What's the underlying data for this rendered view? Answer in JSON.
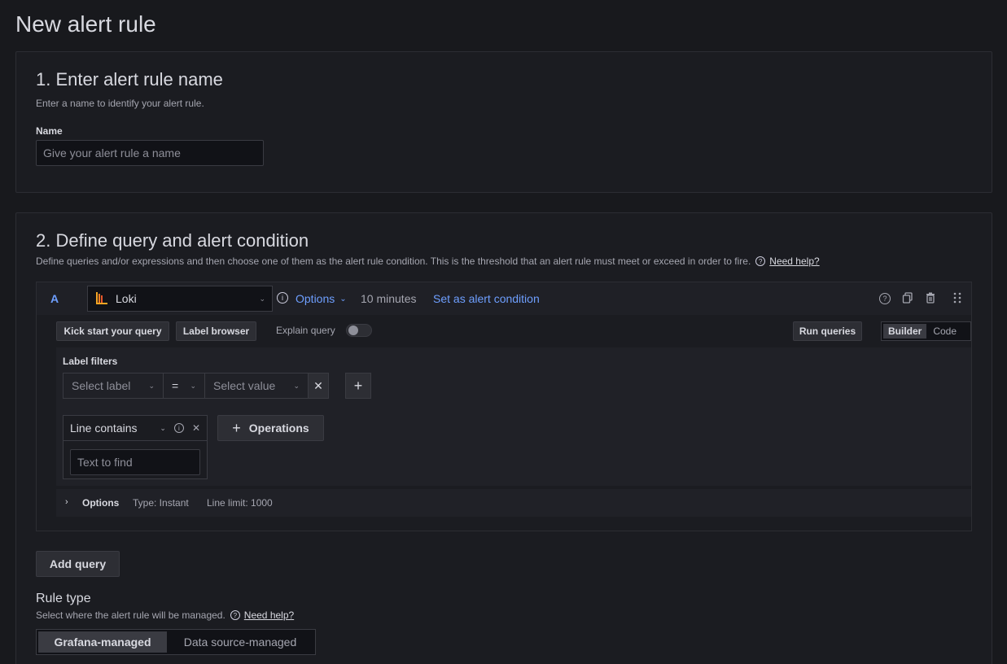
{
  "page": {
    "title": "New alert rule"
  },
  "section1": {
    "title": "1. Enter alert rule name",
    "description": "Enter a name to identify your alert rule.",
    "name_label": "Name",
    "name_placeholder": "Give your alert rule a name"
  },
  "section2": {
    "title": "2. Define query and alert condition",
    "description": "Define queries and/or expressions and then choose one of them as the alert rule condition. This is the threshold that an alert rule must meet or exceed in order to fire.",
    "help_link": "Need help?",
    "query": {
      "ref_id": "A",
      "datasource": "Loki",
      "options_label": "Options",
      "time_range": "10 minutes",
      "set_condition": "Set as alert condition",
      "kick_start": "Kick start your query",
      "label_browser": "Label browser",
      "explain_query": "Explain query",
      "run_queries": "Run queries",
      "mode_builder": "Builder",
      "mode_code": "Code",
      "label_filters_title": "Label filters",
      "select_label": "Select label",
      "operator": "=",
      "select_value": "Select value",
      "line_op": "Line contains",
      "text_placeholder": "Text to find",
      "operations_label": "Operations",
      "options_row": {
        "label": "Options",
        "type": "Type: Instant",
        "line_limit": "Line limit: 1000"
      }
    },
    "add_query": "Add query",
    "rule_type": {
      "title": "Rule type",
      "description": "Select where the alert rule will be managed.",
      "help_link": "Need help?",
      "option_grafana": "Grafana-managed",
      "option_datasource": "Data source-managed"
    }
  }
}
